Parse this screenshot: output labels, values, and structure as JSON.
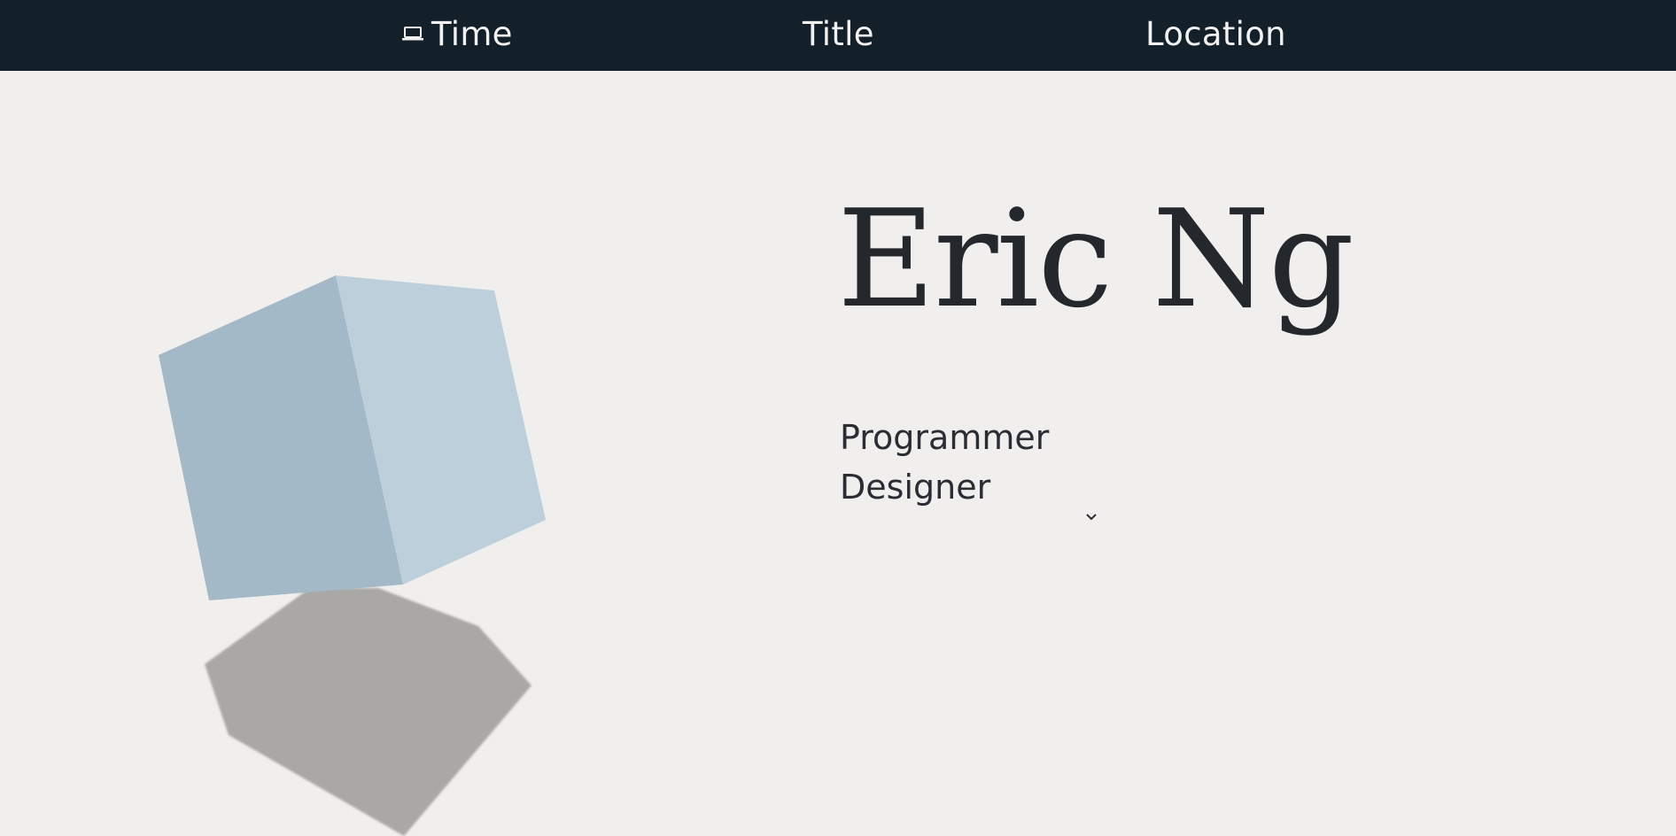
{
  "nav": {
    "time_icon": "laptop-icon",
    "time_label": "Time",
    "title_label": "Title",
    "location_label": "Location"
  },
  "hero": {
    "name": "Eric Ng",
    "roles": [
      "Programmer",
      "Designer"
    ],
    "scroll_icon": "chevron-down-icon"
  },
  "colors": {
    "topbar": "#131f29",
    "background": "#f1efed",
    "text": "#24272c",
    "cube_left_face": "#a3b9c8",
    "cube_right_face": "#bccfda",
    "shadow": "#a9a8a6"
  }
}
